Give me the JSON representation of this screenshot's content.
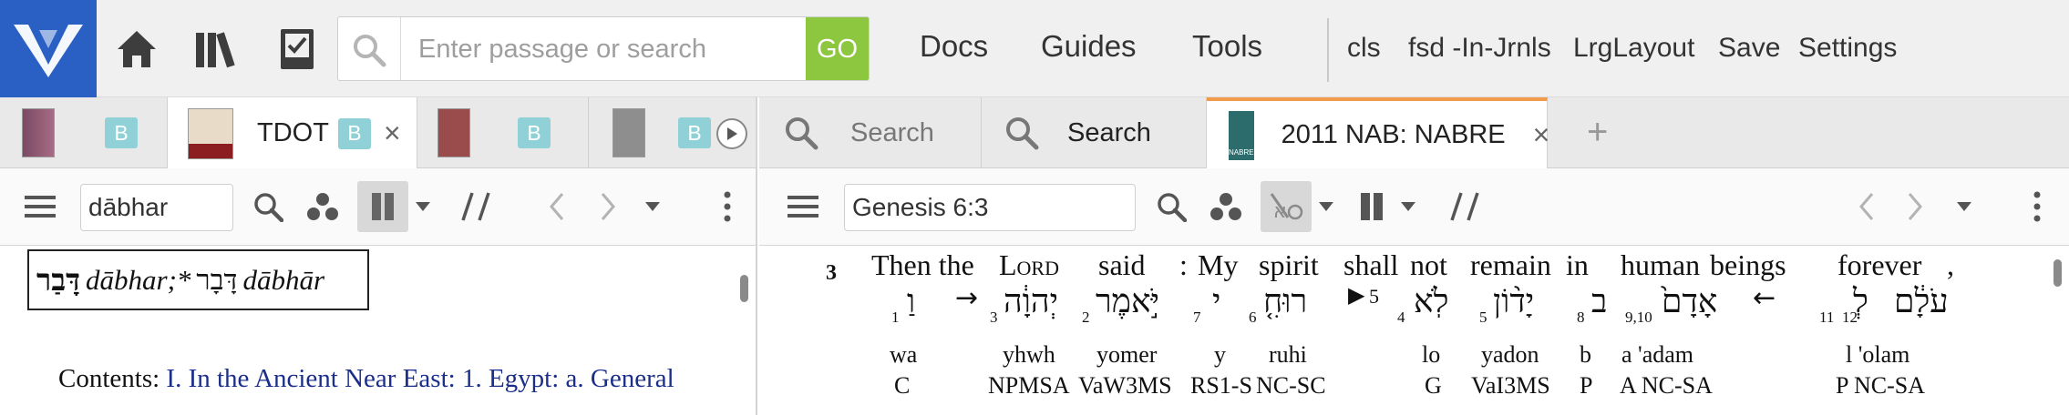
{
  "topbar": {
    "search_placeholder": "Enter passage or search",
    "go_label": "GO",
    "nav": [
      "Docs",
      "Guides",
      "Tools"
    ],
    "shortcuts": [
      "cls",
      "fsd -In-Jrnls",
      "LrgLayout",
      "Save",
      "Settings"
    ]
  },
  "colors": {
    "brand": "#2a5fc4",
    "go": "#8dc63f",
    "badge": "#8fd1d6",
    "active_tab_accent": "#f2994a",
    "link": "#1b2f8a"
  },
  "left_panel": {
    "tabs": [
      {
        "badge": "B"
      },
      {
        "label": "TDOT",
        "badge": "B",
        "close": "×"
      },
      {
        "badge": "B"
      },
      {
        "badge": "B"
      }
    ],
    "reference": "dābhar",
    "headword": {
      "hebrew_bold": "דָּבַר",
      "translit1": "dābhar;*",
      "hebrew2": "דָּבָר",
      "translit2": "dābhār"
    },
    "contents_label": "Contents:",
    "contents_link": "I. In the Ancient Near East: 1. Egypt: a. General"
  },
  "right_panel": {
    "tabs": [
      {
        "label": "Search"
      },
      {
        "label": "Search"
      },
      {
        "label": "2011 NAB: NABRE",
        "close": "×",
        "icon_text": "NABRE"
      }
    ],
    "add_tab": "+",
    "reference": "Genesis 6:3",
    "verse_number": "3",
    "english": [
      "Then the",
      "Lord",
      "said",
      ":",
      "My",
      "spirit",
      "shall",
      "not",
      "remain",
      "in",
      "human",
      "beings",
      "forever",
      ","
    ],
    "hebrew": [
      "וַ",
      "יְהוָ֔ה",
      "יֹּ֣אמֶר",
      "י",
      "רוּחִ֤",
      "▶",
      "לֹֽא",
      "יָד֨וֹן",
      "ב",
      "אָדָם֙",
      "עֹלָ֔ם",
      "לְ"
    ],
    "arrows": [
      "→",
      "←"
    ],
    "subs": [
      "1",
      "3",
      "2",
      "7",
      "6",
      "5",
      "4",
      "5",
      "8",
      "9,10",
      "11",
      "12"
    ],
    "translit": [
      "wa",
      "yhwh",
      "yomer",
      "y",
      "ruhi",
      "lo",
      "yadon",
      "b",
      "a 'adam",
      "l 'olam"
    ],
    "morph": [
      "C",
      "NPMSA",
      "VaW3MS",
      "RS1-S",
      "NC-SC",
      "G",
      "VaI3MS",
      "P",
      "A NC-SA",
      "P NC-SA"
    ]
  }
}
